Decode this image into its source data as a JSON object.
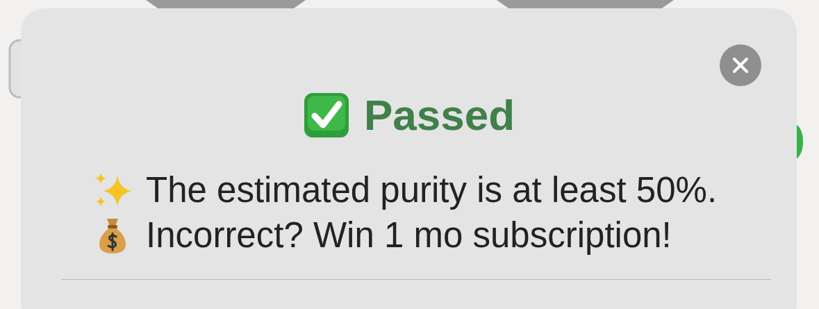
{
  "dialog": {
    "title": "Passed",
    "lines": [
      {
        "kind": "sparkles",
        "text": "The estimated purity is at least 50%."
      },
      {
        "kind": "money",
        "text": "Incorrect? Win 1 mo subscription!"
      }
    ]
  }
}
